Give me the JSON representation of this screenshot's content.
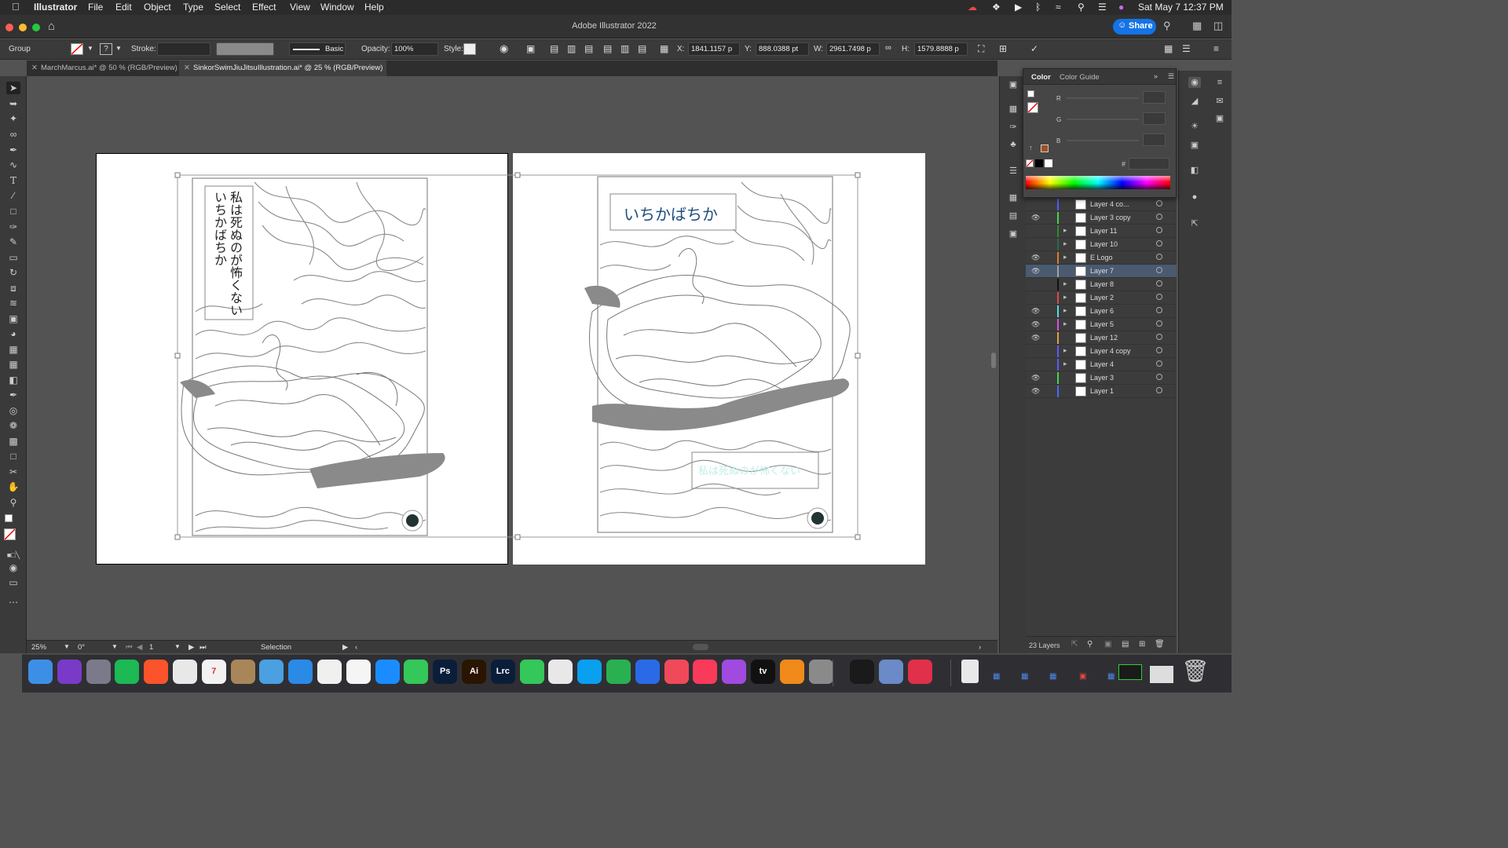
{
  "menubar": {
    "app_name": "Illustrator",
    "items": [
      "File",
      "Edit",
      "Object",
      "Type",
      "Select",
      "Effect",
      "View",
      "Window",
      "Help"
    ],
    "clock": "Sat May 7  12:37 PM"
  },
  "window": {
    "title": "Adobe Illustrator 2022",
    "share_label": "Share"
  },
  "control_bar": {
    "selection_type": "Group",
    "stroke_label": "Stroke:",
    "brush_label": "Basic",
    "opacity_label": "Opacity:",
    "opacity_value": "100%",
    "style_label": "Style:",
    "x_label": "X:",
    "x_value": "1841.1157 p",
    "y_label": "Y:",
    "y_value": "888.0388 pt",
    "w_label": "W:",
    "w_value": "2961.7498 p",
    "h_label": "H:",
    "h_value": "1579.8888 p"
  },
  "tabs": [
    {
      "label": "MarchMarcus.ai* @ 50 % (RGB/Preview)",
      "active": false
    },
    {
      "label": "SinkorSwimJiuJitsuIllustration.ai* @ 25 % (RGB/Preview)",
      "active": true
    }
  ],
  "artwork": {
    "left_vertical_line1": "私は死ぬのが怖くない",
    "left_vertical_line2": "いちかばちか",
    "right_title": "いちかばちか",
    "right_subtitle": "私は死ぬのが怖くない"
  },
  "status_bar": {
    "zoom": "25%",
    "rotation": "0°",
    "artboard": "1",
    "tool": "Selection"
  },
  "color_panel": {
    "tab_color": "Color",
    "tab_guide": "Color Guide",
    "r_label": "R",
    "g_label": "G",
    "b_label": "B",
    "hash_label": "#"
  },
  "layers": {
    "rows": [
      {
        "name": "Layer 4 co...",
        "visible": false,
        "expand": false,
        "color": "#5a5aff"
      },
      {
        "name": "Layer 3 copy",
        "visible": true,
        "expand": false,
        "color": "#4ad24a"
      },
      {
        "name": "Layer 11",
        "visible": false,
        "expand": true,
        "color": "#2a8c2a"
      },
      {
        "name": "Layer 10",
        "visible": false,
        "expand": true,
        "color": "#2a6a4a"
      },
      {
        "name": "E Logo",
        "visible": true,
        "expand": true,
        "color": "#e07a2a"
      },
      {
        "name": "Layer 7",
        "visible": true,
        "expand": false,
        "color": "#a0a0a0",
        "selected": true
      },
      {
        "name": "Layer 8",
        "visible": false,
        "expand": true,
        "color": "#111111"
      },
      {
        "name": "Layer 2",
        "visible": false,
        "expand": true,
        "color": "#e04a4a"
      },
      {
        "name": "Layer 6",
        "visible": true,
        "expand": true,
        "color": "#4ae0e0"
      },
      {
        "name": "Layer 5",
        "visible": true,
        "expand": true,
        "color": "#e04ae0"
      },
      {
        "name": "Layer 12",
        "visible": true,
        "expand": false,
        "color": "#e0a04a"
      },
      {
        "name": "Layer 4 copy",
        "visible": false,
        "expand": true,
        "color": "#5a5aff"
      },
      {
        "name": "Layer 4",
        "visible": false,
        "expand": true,
        "color": "#5a5aff"
      },
      {
        "name": "Layer 3",
        "visible": true,
        "expand": false,
        "color": "#4ad24a"
      },
      {
        "name": "Layer 1",
        "visible": true,
        "expand": false,
        "color": "#4a6aff"
      }
    ],
    "count_label": "23 Layers"
  },
  "dock": {
    "apps": [
      {
        "name": "Finder",
        "color": "#3d8fe6",
        "label": ""
      },
      {
        "name": "Siri",
        "color": "#7a3ac8",
        "label": ""
      },
      {
        "name": "Launchpad",
        "color": "#7a7a8a",
        "label": ""
      },
      {
        "name": "Spotify",
        "color": "#1db954",
        "label": ""
      },
      {
        "name": "Brave",
        "color": "#fb542b",
        "label": ""
      },
      {
        "name": "Chrome",
        "color": "#e8e8e8",
        "label": ""
      },
      {
        "name": "Calendar",
        "color": "#f2f2f2",
        "label": "7"
      },
      {
        "name": "Contacts",
        "color": "#a8865a",
        "label": ""
      },
      {
        "name": "Maps",
        "color": "#4aa0e0",
        "label": ""
      },
      {
        "name": "Safari",
        "color": "#2a8ae6",
        "label": ""
      },
      {
        "name": "Photos",
        "color": "#f0f0f0",
        "label": ""
      },
      {
        "name": "Reminders",
        "color": "#f5f5f5",
        "label": ""
      },
      {
        "name": "App Store",
        "color": "#1a8cff",
        "label": ""
      },
      {
        "name": "Messages",
        "color": "#34c759",
        "label": ""
      },
      {
        "name": "Photoshop",
        "color": "#0a1e3a",
        "label": "Ps"
      },
      {
        "name": "Illustrator",
        "color": "#2a1500",
        "label": "Ai"
      },
      {
        "name": "Lightroom Classic",
        "color": "#0a1e3a",
        "label": "Lrc"
      },
      {
        "name": "FaceTime",
        "color": "#34c759",
        "label": ""
      },
      {
        "name": "Script Editor",
        "color": "#e8e8e8",
        "label": ""
      },
      {
        "name": "Skype",
        "color": "#0aa0f0",
        "label": ""
      },
      {
        "name": "Numbers",
        "color": "#2ab050",
        "label": ""
      },
      {
        "name": "Keynote",
        "color": "#2a6ae6",
        "label": ""
      },
      {
        "name": "News",
        "color": "#f04a5a",
        "label": ""
      },
      {
        "name": "Music",
        "color": "#fa3a5a",
        "label": ""
      },
      {
        "name": "Podcasts",
        "color": "#a04ae0",
        "label": ""
      },
      {
        "name": "TV",
        "color": "#111111",
        "label": "tv"
      },
      {
        "name": "Books",
        "color": "#f08a1a",
        "label": ""
      },
      {
        "name": "System Preferences",
        "color": "#8a8a8a",
        "label": ""
      },
      {
        "name": "Activity Monitor",
        "color": "#1a1a1a",
        "label": ""
      },
      {
        "name": "Preview",
        "color": "#6a8ac8",
        "label": ""
      },
      {
        "name": "Creative Cloud",
        "color": "#e0304a",
        "label": ""
      }
    ]
  }
}
